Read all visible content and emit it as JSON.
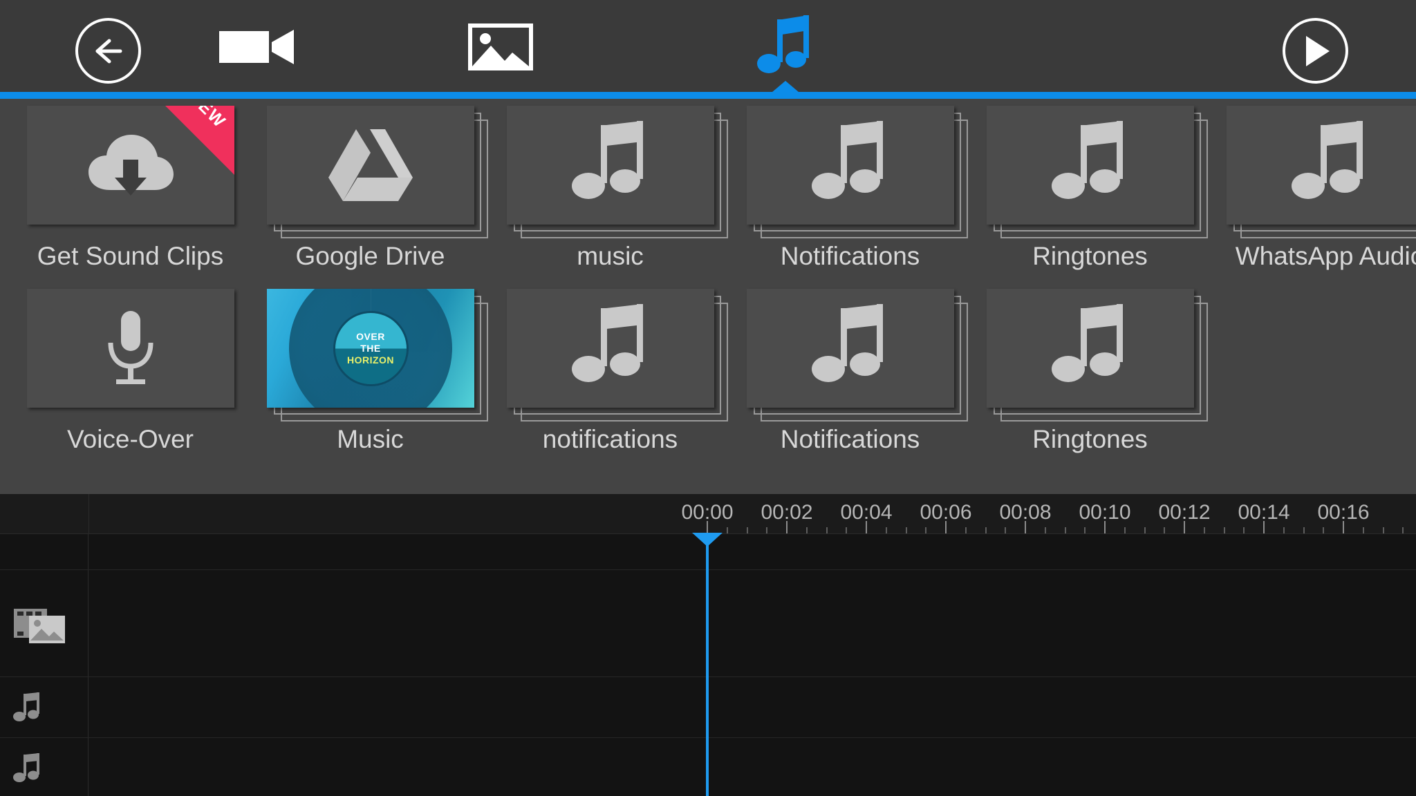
{
  "toolbar": {
    "back_label": "Back",
    "tabs": [
      {
        "id": "video",
        "icon": "video-camera-icon",
        "label": "Video",
        "active": false
      },
      {
        "id": "image",
        "icon": "photo-icon",
        "label": "Image",
        "active": false
      },
      {
        "id": "audio",
        "icon": "music-note-icon",
        "label": "Audio",
        "active": true
      }
    ],
    "play_label": "Play",
    "accent_color": "#0c8ce9"
  },
  "browser": {
    "background": "#444444",
    "tile_color": "#4c4c4c",
    "new_badge_color": "#f0305c",
    "new_badge_text": "NEW",
    "items": [
      {
        "label": "Get Sound Clips",
        "icon": "cloud-download-icon",
        "stacked": false,
        "badge": "NEW",
        "row": 0,
        "col": 0
      },
      {
        "label": "Google Drive",
        "icon": "google-drive-icon",
        "stacked": true,
        "badge": "",
        "row": 0,
        "col": 1
      },
      {
        "label": "music",
        "icon": "music-note-icon",
        "stacked": true,
        "badge": "",
        "row": 0,
        "col": 2
      },
      {
        "label": "Notifications",
        "icon": "music-note-icon",
        "stacked": true,
        "badge": "",
        "row": 0,
        "col": 3
      },
      {
        "label": "Ringtones",
        "icon": "music-note-icon",
        "stacked": true,
        "badge": "",
        "row": 0,
        "col": 4
      },
      {
        "label": "WhatsApp Audio",
        "icon": "music-note-icon",
        "stacked": true,
        "badge": "",
        "row": 0,
        "col": 5
      },
      {
        "label": "Voice-Over",
        "icon": "microphone-icon",
        "stacked": false,
        "badge": "",
        "row": 1,
        "col": 0
      },
      {
        "label": "Music",
        "icon": "album-art",
        "stacked": true,
        "badge": "",
        "row": 1,
        "col": 1
      },
      {
        "label": "notifications",
        "icon": "music-note-icon",
        "stacked": true,
        "badge": "",
        "row": 1,
        "col": 2
      },
      {
        "label": "Notifications",
        "icon": "music-note-icon",
        "stacked": true,
        "badge": "",
        "row": 1,
        "col": 3
      },
      {
        "label": "Ringtones",
        "icon": "music-note-icon",
        "stacked": true,
        "badge": "",
        "row": 1,
        "col": 4
      }
    ],
    "album_art": {
      "line1": "OVER",
      "line2": "THE",
      "line3": "HORIZON",
      "title_color": "#ffffff",
      "accent_color": "#e9f06a"
    }
  },
  "timeline": {
    "ruler_labels": [
      "00:00",
      "00:02",
      "00:04",
      "00:06",
      "00:08",
      "00:10",
      "00:12",
      "00:14",
      "00:16"
    ],
    "playhead_time": "00:00",
    "playhead_color": "#1f9bf0",
    "tracks": [
      {
        "id": "video-track",
        "icon": "filmstrip-photo-icon"
      },
      {
        "id": "audio-track-1",
        "icon": "music-note-icon"
      },
      {
        "id": "audio-track-2",
        "icon": "music-note-icon"
      }
    ]
  }
}
